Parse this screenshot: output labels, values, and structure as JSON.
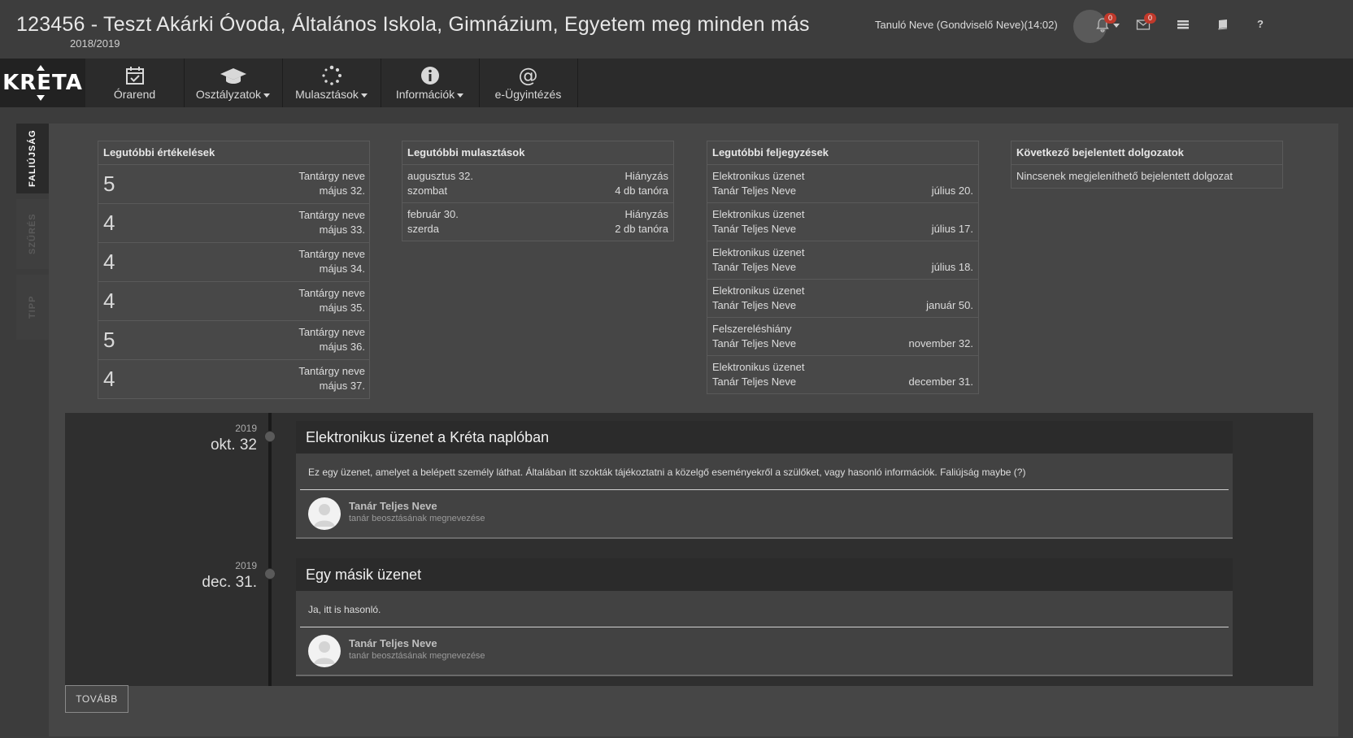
{
  "header": {
    "institution_title": "123456 - Teszt Akárki Óvoda, Általános Iskola, Gimnázium, Egyetem meg minden más",
    "school_year": "2018/2019",
    "user_label": "Tanuló Neve (Gondviselő Neve)(14:02)",
    "notification_count": "0",
    "message_count": "0",
    "icons": [
      "bell-icon",
      "mail-icon",
      "list-icon",
      "book-icon",
      "help-icon"
    ]
  },
  "nav": {
    "logo_text": "KRETA",
    "items": [
      {
        "label": "Órarend",
        "icon": "calendar-check-icon"
      },
      {
        "label": "Osztályzatok",
        "icon": "graduation-cap-icon"
      },
      {
        "label": "Mulasztások",
        "icon": "spinner-icon"
      },
      {
        "label": "Információk",
        "icon": "info-icon"
      },
      {
        "label": "e-Ügyintézés",
        "icon": "at-icon"
      }
    ]
  },
  "side_tabs": [
    "FALIÚJSÁG",
    "SZŰRÉS",
    "TIPP"
  ],
  "grades": {
    "title": "Legutóbbi értékelések",
    "rows": [
      {
        "grade": "5",
        "subject": "Tantárgy neve",
        "date": "május 32."
      },
      {
        "grade": "4",
        "subject": "Tantárgy neve",
        "date": "május 33."
      },
      {
        "grade": "4",
        "subject": "Tantárgy neve",
        "date": "május 34."
      },
      {
        "grade": "4",
        "subject": "Tantárgy neve",
        "date": "május 35."
      },
      {
        "grade": "5",
        "subject": "Tantárgy neve",
        "date": "május 36."
      },
      {
        "grade": "4",
        "subject": "Tantárgy neve",
        "date": "május 37."
      }
    ]
  },
  "absences": {
    "title": "Legutóbbi mulasztások",
    "rows": [
      {
        "date": "augusztus 32.",
        "day": "szombat",
        "type": "Hiányzás",
        "count": "4 db tanóra"
      },
      {
        "date": "február 30.",
        "day": "szerda",
        "type": "Hiányzás",
        "count": "2 db tanóra"
      }
    ]
  },
  "notes": {
    "title": "Legutóbbi feljegyzések",
    "rows": [
      {
        "type": "Elektronikus üzenet",
        "teacher": "Tanár Teljes Neve",
        "date": "július 20."
      },
      {
        "type": "Elektronikus üzenet",
        "teacher": "Tanár Teljes Neve",
        "date": "július 17."
      },
      {
        "type": "Elektronikus üzenet",
        "teacher": "Tanár Teljes Neve",
        "date": "július 18."
      },
      {
        "type": "Elektronikus üzenet",
        "teacher": "Tanár Teljes Neve",
        "date": "január 50."
      },
      {
        "type": "Felszereléshiány",
        "teacher": "Tanár Teljes Neve",
        "date": "november 32."
      },
      {
        "type": "Elektronikus üzenet",
        "teacher": "Tanár Teljes Neve",
        "date": "december 31."
      }
    ]
  },
  "exams": {
    "title": "Következő bejelentett dolgozatok",
    "empty_text": "Nincsenek megjeleníthető bejelentett dolgozat"
  },
  "timeline": [
    {
      "year": "2019",
      "date": "okt. 32",
      "title": "Elektronikus üzenet a Kréta naplóban",
      "body": "Ez egy üzenet, amelyet a belépett személy láthat. Általában itt szokták tájékoztatni a közelgő eseményekről a szülőket, vagy hasonló információk. Faliújság maybe (?)",
      "author": "Tanár Teljes Neve",
      "role": "tanár beosztásának megnevezése"
    },
    {
      "year": "2019",
      "date": "dec. 31.",
      "title": "Egy másik üzenet",
      "body": "Ja, itt is hasonló.",
      "author": "Tanár Teljes Neve",
      "role": "tanár beosztásának megnevezése"
    }
  ],
  "more_button": "TOVÁBB"
}
